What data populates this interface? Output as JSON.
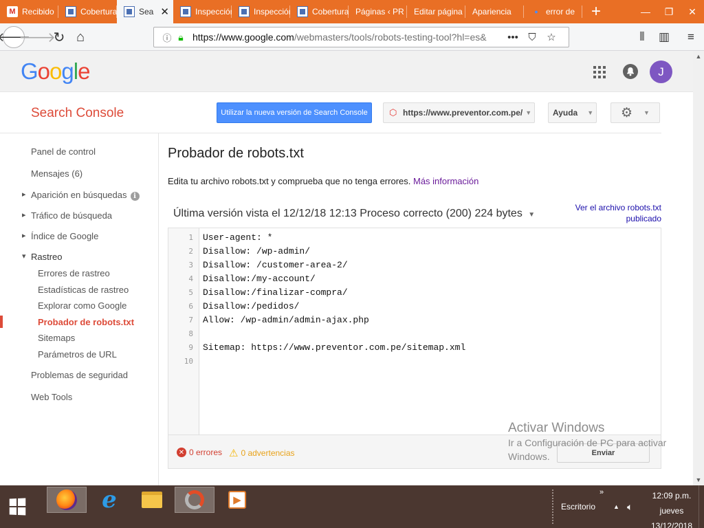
{
  "browser": {
    "tabs": [
      {
        "title": "Recibido",
        "icon": "gmail-icon"
      },
      {
        "title": "Cobertura",
        "icon": "search-console-icon"
      },
      {
        "title": "Search",
        "icon": "search-console-icon",
        "active": true
      },
      {
        "title": "Inspección",
        "icon": "search-console-icon"
      },
      {
        "title": "Inspección",
        "icon": "search-console-icon"
      },
      {
        "title": "Cobertura",
        "icon": "search-console-icon"
      },
      {
        "title": "Páginas ‹ PR",
        "icon": ""
      },
      {
        "title": "Editar página",
        "icon": ""
      },
      {
        "title": "Apariencia",
        "icon": ""
      },
      {
        "title": "error de",
        "icon": "dot-icon"
      }
    ],
    "new_tab": "+",
    "url_domain": "https://www.google.com",
    "url_path": "/webmasters/tools/robots-testing-tool?hl=es&",
    "url_more": "•••"
  },
  "google": {
    "logo": [
      "G",
      "o",
      "o",
      "g",
      "l",
      "e"
    ],
    "avatar_letter": "J"
  },
  "console": {
    "title": "Search Console",
    "new_version_button": "Utilizar la nueva versión de Search Console",
    "site": "https://www.preventor.com.pe/",
    "help": "Ayuda"
  },
  "sidebar": {
    "items": [
      "Panel de control",
      "Mensajes (6)",
      "Aparición en búsquedas",
      "Tráfico de búsqueda",
      "Índice de Google",
      "Rastreo",
      "Errores de rastreo",
      "Estadísticas de rastreo",
      "Explorar como Google",
      "Probador de robots.txt",
      "Sitemaps",
      "Parámetros de URL",
      "Problemas de seguridad",
      "Web Tools"
    ]
  },
  "main": {
    "title": "Probador de robots.txt",
    "description": "Edita tu archivo robots.txt y comprueba que no tenga errores.",
    "more_info": "Más información",
    "version": "Última versión vista el 12/12/18 12:13 Proceso correcto (200) 224 bytes",
    "view_link_1": "Ver el archivo robots.txt",
    "view_link_2": "publicado",
    "line_numbers": [
      "1",
      "2",
      "3",
      "4",
      "5",
      "6",
      "7",
      "8",
      "9",
      "10"
    ],
    "code_lines": [
      "User-agent: *",
      "Disallow: /wp-admin/",
      "Disallow: /customer-area-2/",
      "Disallow:/my-account/",
      "Disallow:/finalizar-compra/",
      "Disallow:/pedidos/",
      "Allow: /wp-admin/admin-ajax.php",
      "",
      "Sitemap: https://www.preventor.com.pe/sitemap.xml",
      ""
    ],
    "errors": "0 errores",
    "warnings": "0 advertencias",
    "submit": "Enviar"
  },
  "watermark": {
    "line1": "Activar Windows",
    "line2": "Ir a Configuración de PC para activar Windows."
  },
  "taskbar": {
    "escritorio": "Escritorio",
    "more": "»",
    "time": "12:09 p.m.",
    "day": "jueves",
    "date": "13/12/2018"
  }
}
